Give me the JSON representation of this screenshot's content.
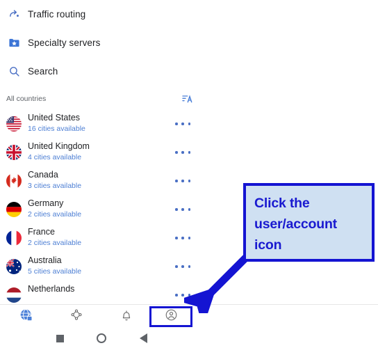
{
  "app": {
    "menu": [
      {
        "label": "Traffic routing",
        "icon": "traffic-routing-icon"
      },
      {
        "label": "Specialty servers",
        "icon": "specialty-servers-icon"
      },
      {
        "label": "Search",
        "icon": "search-icon"
      }
    ],
    "section": {
      "title": "All countries",
      "sort_icon": "sort-alphabetical-icon"
    },
    "countries": [
      {
        "name": "United States",
        "subtitle": "16 cities available",
        "flag": "flag-us"
      },
      {
        "name": "United Kingdom",
        "subtitle": "4 cities available",
        "flag": "flag-gb"
      },
      {
        "name": "Canada",
        "subtitle": "3 cities available",
        "flag": "flag-ca"
      },
      {
        "name": "Germany",
        "subtitle": "2 cities available",
        "flag": "flag-de"
      },
      {
        "name": "France",
        "subtitle": "2 cities available",
        "flag": "flag-fr"
      },
      {
        "name": "Australia",
        "subtitle": "5 cities available",
        "flag": "flag-au"
      },
      {
        "name": "Netherlands",
        "subtitle": "",
        "flag": "flag-nl"
      }
    ],
    "bottom_nav": [
      {
        "name": "vpn-globe-icon",
        "label": "",
        "active": true
      },
      {
        "name": "mesh-net-icon",
        "label": "",
        "active": false
      },
      {
        "name": "alerts-bell-icon",
        "label": "",
        "active": false
      },
      {
        "name": "account-icon",
        "label": "",
        "active": false
      }
    ],
    "system_nav": [
      "recents-square",
      "home-circle",
      "back-triangle"
    ]
  },
  "annotation": {
    "callout_text": "Click the\nuser/account\nicon",
    "border_color": "#1414d2",
    "fill_color": "#cfe0f2",
    "text_color": "#1a1ad0"
  },
  "colors": {
    "accent_blue": "#4a6fc4",
    "subtitle_blue": "#4d7fd4",
    "text_primary": "#202124",
    "text_secondary": "#5f6368"
  }
}
